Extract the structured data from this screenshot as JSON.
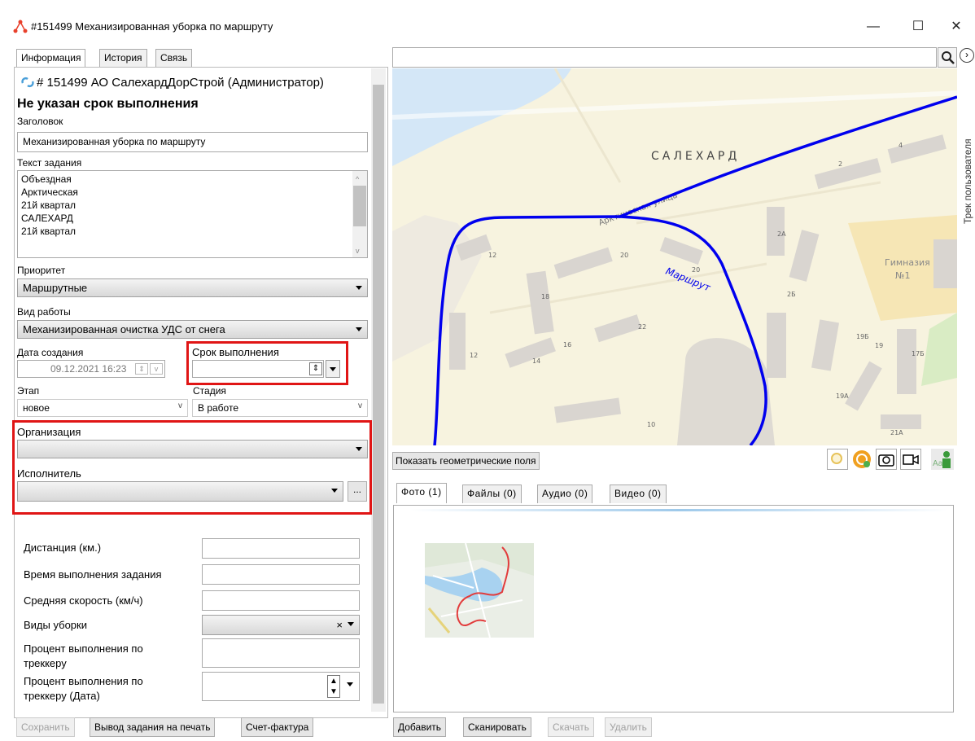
{
  "window": {
    "title": "#151499 Механизированная уборка по маршруту",
    "minimize": "—",
    "maximize": "☐",
    "close": "✕"
  },
  "tabs": [
    "Информация",
    "История",
    "Связь"
  ],
  "header": {
    "task_line": "# 151499  АО СалехардДорСтрой (Администратор)",
    "deadline_warning": "Не указан срок выполнения"
  },
  "form": {
    "title_label": "Заголовок",
    "title_value": "Механизированная уборка по маршруту",
    "text_label": "Текст задания",
    "text_lines": [
      "Объездная",
      "Арктическая",
      "21й квартал",
      "САЛЕХАРД",
      "21й квартал"
    ],
    "priority_label": "Приоритет",
    "priority_value": "Маршрутные",
    "worktype_label": "Вид работы",
    "worktype_value": "Механизированная очистка УДС от снега",
    "created_label": "Дата создания",
    "created_value": "09.12.2021 16:23",
    "deadline_label": "Срок выполнения",
    "deadline_value": "",
    "stage_label": "Этап",
    "stage_value": "новое",
    "phase_label": "Стадия",
    "phase_value": "В работе",
    "org_label": "Организация",
    "org_value": "",
    "executor_label": "Исполнитель",
    "executor_value": "",
    "browse": "...",
    "distance_label": "Дистанция (км.)",
    "time_label": "Время выполнения задания",
    "speed_label": "Средняя скорость (км/ч)",
    "cleaning_label": "Виды уборки",
    "clear_x": "×",
    "percent_label": "Процент выполнения по треккеру",
    "percent_date_label": "Процент выполнения по треккеру (Дата)"
  },
  "buttons": {
    "save": "Сохранить",
    "print": "Вывод задания на печать",
    "invoice": "Счет-фактура",
    "add": "Добавить",
    "scan": "Сканировать",
    "download": "Скачать",
    "delete": "Удалить",
    "show_geometry": "Показать геометрические поля"
  },
  "map": {
    "search_placeholder": "",
    "side_tab": "Трек пользователя",
    "city": "САЛЕХАРД",
    "route_label": "Маршрут",
    "street": "Арктическая улица",
    "school": "Гимназия",
    "school_num": "№1",
    "house_numbers": [
      "4",
      "2",
      "2А",
      "12",
      "20",
      "20",
      "18",
      "2Б",
      "16",
      "22",
      "12",
      "14",
      "19Б",
      "19",
      "17Б",
      "19А",
      "10",
      "21А"
    ],
    "route_color": "#0000ee"
  },
  "media_tabs": [
    "Фото (1)",
    "Файлы (0)",
    "Аудио (0)",
    "Видео (0)"
  ]
}
